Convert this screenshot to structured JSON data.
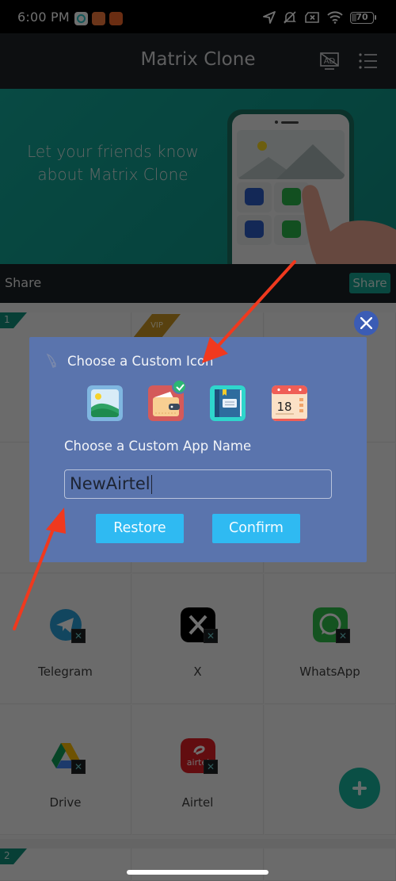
{
  "status_bar": {
    "time": "6:00 PM",
    "notification_icons": [
      "app-notification-icon",
      "shopping-notification-icon",
      "video-notification-icon"
    ],
    "system_icons": [
      "location-icon",
      "mute-icon",
      "no-sim-icon",
      "wifi-icon",
      "battery-icon"
    ],
    "battery_level": "70"
  },
  "app_bar": {
    "title": "Matrix Clone",
    "actions": [
      "remove-ads-icon",
      "menu-list-icon"
    ]
  },
  "banner": {
    "line1": "Let your friends know",
    "line2": "about Matrix Clone"
  },
  "share_bar": {
    "label": "Share",
    "button_label": "Share"
  },
  "grid": {
    "page_tags": [
      "1",
      "2"
    ],
    "vip_tag": "VIP",
    "apps": [
      {
        "name": "Telegram",
        "icon": "telegram-icon",
        "color": "#2a9fd8"
      },
      {
        "name": "X",
        "icon": "x-icon",
        "color": "#000000"
      },
      {
        "name": "WhatsApp",
        "icon": "whatsapp-icon",
        "color": "#2fbd4a"
      },
      {
        "name": "Drive",
        "icon": "google-drive-icon",
        "color": "#ffffff"
      },
      {
        "name": "Airtel",
        "icon": "airtel-icon",
        "color": "#e01e25"
      }
    ],
    "clone_badge": "✕"
  },
  "dialog": {
    "title": "Choose a Custom Icon",
    "icon_choices": [
      {
        "name": "gallery",
        "selected": false
      },
      {
        "name": "wallet",
        "selected": true
      },
      {
        "name": "notebook",
        "selected": false
      },
      {
        "name": "calendar",
        "selected": false,
        "calendar_day": "18"
      }
    ],
    "subtitle": "Choose a Custom App Name",
    "name_input_value": "NewAirtel",
    "restore_label": "Restore",
    "confirm_label": "Confirm"
  },
  "colors": {
    "accent_teal": "#16a28f",
    "dialog_bg": "#5a74ad",
    "dialog_button": "#2fbaf2",
    "close_button": "#3b5cb5",
    "annotation_arrow": "#f0391e"
  }
}
